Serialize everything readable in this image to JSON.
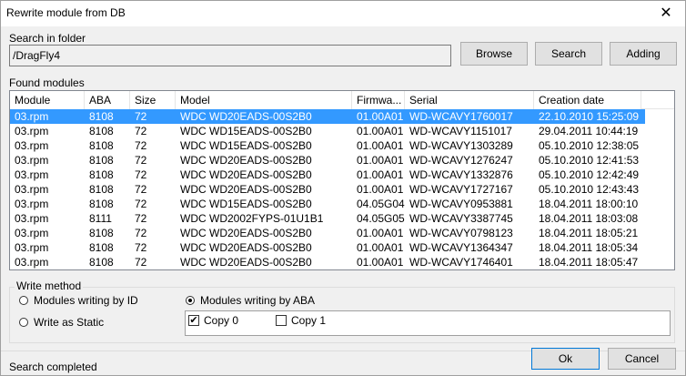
{
  "window": {
    "title": "Rewrite module from DB"
  },
  "search": {
    "label": "Search in folder",
    "folder_value": "/DragFly4"
  },
  "buttons": {
    "browse": "Browse",
    "search": "Search",
    "adding": "Adding",
    "ok": "Ok",
    "cancel": "Cancel"
  },
  "found": {
    "label": "Found modules",
    "columns": [
      "Module",
      "ABA",
      "Size",
      "Model",
      "Firmwa...",
      "Serial",
      "Creation date"
    ],
    "rows": [
      [
        "03.rpm",
        "8108",
        "72",
        "WDC WD20EADS-00S2B0",
        "01.00A01",
        "WD-WCAVY1760017",
        "22.10.2010 15:25:09"
      ],
      [
        "03.rpm",
        "8108",
        "72",
        "WDC WD15EADS-00S2B0",
        "01.00A01",
        "WD-WCAVY1151017",
        "29.04.2011 10:44:19"
      ],
      [
        "03.rpm",
        "8108",
        "72",
        "WDC WD15EADS-00S2B0",
        "01.00A01",
        "WD-WCAVY1303289",
        "05.10.2010 12:38:05"
      ],
      [
        "03.rpm",
        "8108",
        "72",
        "WDC WD20EADS-00S2B0",
        "01.00A01",
        "WD-WCAVY1276247",
        "05.10.2010 12:41:53"
      ],
      [
        "03.rpm",
        "8108",
        "72",
        "WDC WD20EADS-00S2B0",
        "01.00A01",
        "WD-WCAVY1332876",
        "05.10.2010 12:42:49"
      ],
      [
        "03.rpm",
        "8108",
        "72",
        "WDC WD20EADS-00S2B0",
        "01.00A01",
        "WD-WCAVY1727167",
        "05.10.2010 12:43:43"
      ],
      [
        "03.rpm",
        "8108",
        "72",
        "WDC WD15EADS-00S2B0",
        "04.05G04",
        "WD-WCAVY0953881",
        "18.04.2011 18:00:10"
      ],
      [
        "03.rpm",
        "8111",
        "72",
        "WDC WD2002FYPS-01U1B1",
        "04.05G05",
        "WD-WCAVY3387745",
        "18.04.2011 18:03:08"
      ],
      [
        "03.rpm",
        "8108",
        "72",
        "WDC WD20EADS-00S2B0",
        "01.00A01",
        "WD-WCAVY0798123",
        "18.04.2011 18:05:21"
      ],
      [
        "03.rpm",
        "8108",
        "72",
        "WDC WD20EADS-00S2B0",
        "01.00A01",
        "WD-WCAVY1364347",
        "18.04.2011 18:05:34"
      ],
      [
        "03.rpm",
        "8108",
        "72",
        "WDC WD20EADS-00S2B0",
        "01.00A01",
        "WD-WCAVY1746401",
        "18.04.2011 18:05:47"
      ]
    ],
    "selected_row": 0
  },
  "write_method": {
    "label": "Write method",
    "by_id": "Modules writing by ID",
    "by_aba": "Modules writing by ABA",
    "static": "Write as Static",
    "selected": "by_aba",
    "copy0": {
      "label": "Copy 0",
      "checked": true
    },
    "copy1": {
      "label": "Copy 1",
      "checked": false
    }
  },
  "status": {
    "text": "Search completed"
  },
  "colors": {
    "selection": "#3399ff",
    "default_button_border": "#0078d7"
  },
  "icons": {
    "close": "close-icon"
  }
}
